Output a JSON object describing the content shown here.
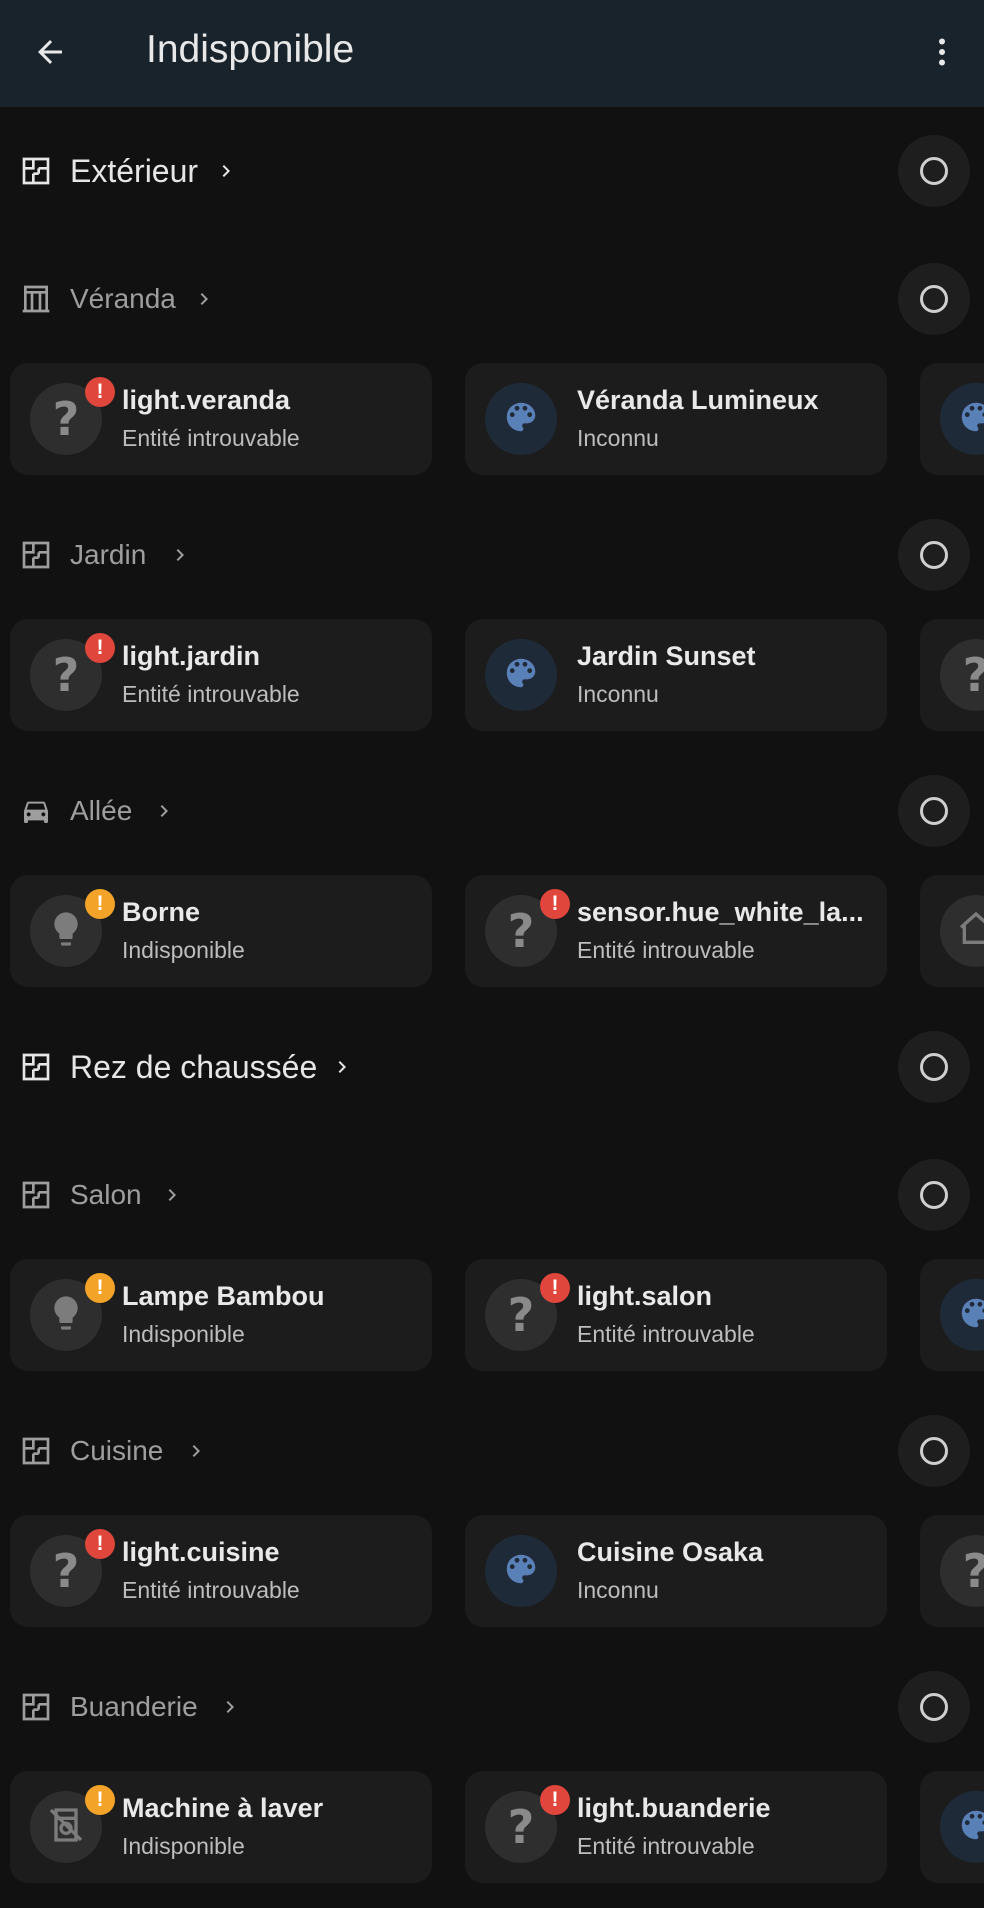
{
  "header": {
    "title": "Indisponible"
  },
  "sections": [
    {
      "kind": "floor",
      "label": "Extérieur",
      "icon": "floor-plan-icon",
      "cards": []
    },
    {
      "kind": "area",
      "label": "Véranda",
      "icon": "door-icon",
      "cards": [
        {
          "name": "light.veranda",
          "state": "Entité introuvable",
          "icon": "question-icon",
          "badge": "error"
        },
        {
          "name": "Véranda Lumineux",
          "state": "Inconnu",
          "icon": "palette-icon",
          "badge": ""
        },
        {
          "icon": "palette-icon"
        }
      ]
    },
    {
      "kind": "area",
      "label": "Jardin",
      "icon": "floor-plan-icon",
      "cards": [
        {
          "name": "light.jardin",
          "state": "Entité introuvable",
          "icon": "question-icon",
          "badge": "error"
        },
        {
          "name": "Jardin Sunset",
          "state": "Inconnu",
          "icon": "palette-icon",
          "badge": ""
        },
        {
          "icon": "question-icon"
        }
      ]
    },
    {
      "kind": "area",
      "label": "Allée",
      "icon": "car-icon",
      "cards": [
        {
          "name": "Borne",
          "state": "Indisponible",
          "icon": "bulb-icon",
          "badge": "warning"
        },
        {
          "name": "sensor.hue_white_la...",
          "state": "Entité introuvable",
          "icon": "question-icon",
          "badge": "error"
        },
        {
          "icon": "home-icon"
        }
      ]
    },
    {
      "kind": "floor",
      "label": "Rez de chaussée",
      "icon": "floor-plan-icon",
      "cards": []
    },
    {
      "kind": "area",
      "label": "Salon",
      "icon": "floor-plan-icon",
      "cards": [
        {
          "name": "Lampe Bambou",
          "state": "Indisponible",
          "icon": "bulb-icon",
          "badge": "warning"
        },
        {
          "name": "light.salon",
          "state": "Entité introuvable",
          "icon": "question-icon",
          "badge": "error"
        },
        {
          "icon": "palette-icon"
        }
      ]
    },
    {
      "kind": "area",
      "label": "Cuisine",
      "icon": "floor-plan-icon",
      "cards": [
        {
          "name": "light.cuisine",
          "state": "Entité introuvable",
          "icon": "question-icon",
          "badge": "error"
        },
        {
          "name": "Cuisine Osaka",
          "state": "Inconnu",
          "icon": "palette-icon",
          "badge": ""
        },
        {
          "icon": "question-icon"
        }
      ]
    },
    {
      "kind": "area",
      "label": "Buanderie",
      "icon": "floor-plan-icon",
      "cards": [
        {
          "name": "Machine à laver",
          "state": "Indisponible",
          "icon": "washer-off-icon",
          "badge": "warning"
        },
        {
          "name": "light.buanderie",
          "state": "Entité introuvable",
          "icon": "question-icon",
          "badge": "error"
        },
        {
          "icon": "palette-icon"
        }
      ]
    }
  ],
  "badge_glyph": "!",
  "question_glyph": "?",
  "colors": {
    "background": "#111111",
    "header": "#18232b",
    "card": "#1c1c1c",
    "error_badge": "#e0463b",
    "warning_badge": "#f3a328",
    "palette_icon": "#5a80b8"
  }
}
